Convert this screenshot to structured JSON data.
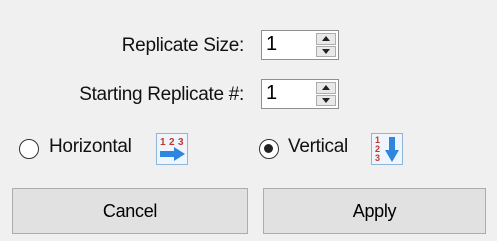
{
  "replicate_size": {
    "label": "Replicate Size:",
    "value": "1"
  },
  "starting_replicate": {
    "label": "Starting Replicate #:",
    "value": "1"
  },
  "orientation": {
    "horizontal": {
      "label": "Horizontal",
      "selected": false,
      "icon": "horizontal-order-icon",
      "icon_digits": [
        "1",
        "2",
        "3"
      ]
    },
    "vertical": {
      "label": "Vertical",
      "selected": true,
      "icon": "vertical-order-icon",
      "icon_digits": [
        "1",
        "2",
        "3"
      ]
    }
  },
  "buttons": {
    "cancel_label": "Cancel",
    "apply_label": "Apply"
  },
  "colors": {
    "background": "#f0f0f0",
    "icon_digits": "#c0392b",
    "icon_arrow": "#2e86de"
  }
}
